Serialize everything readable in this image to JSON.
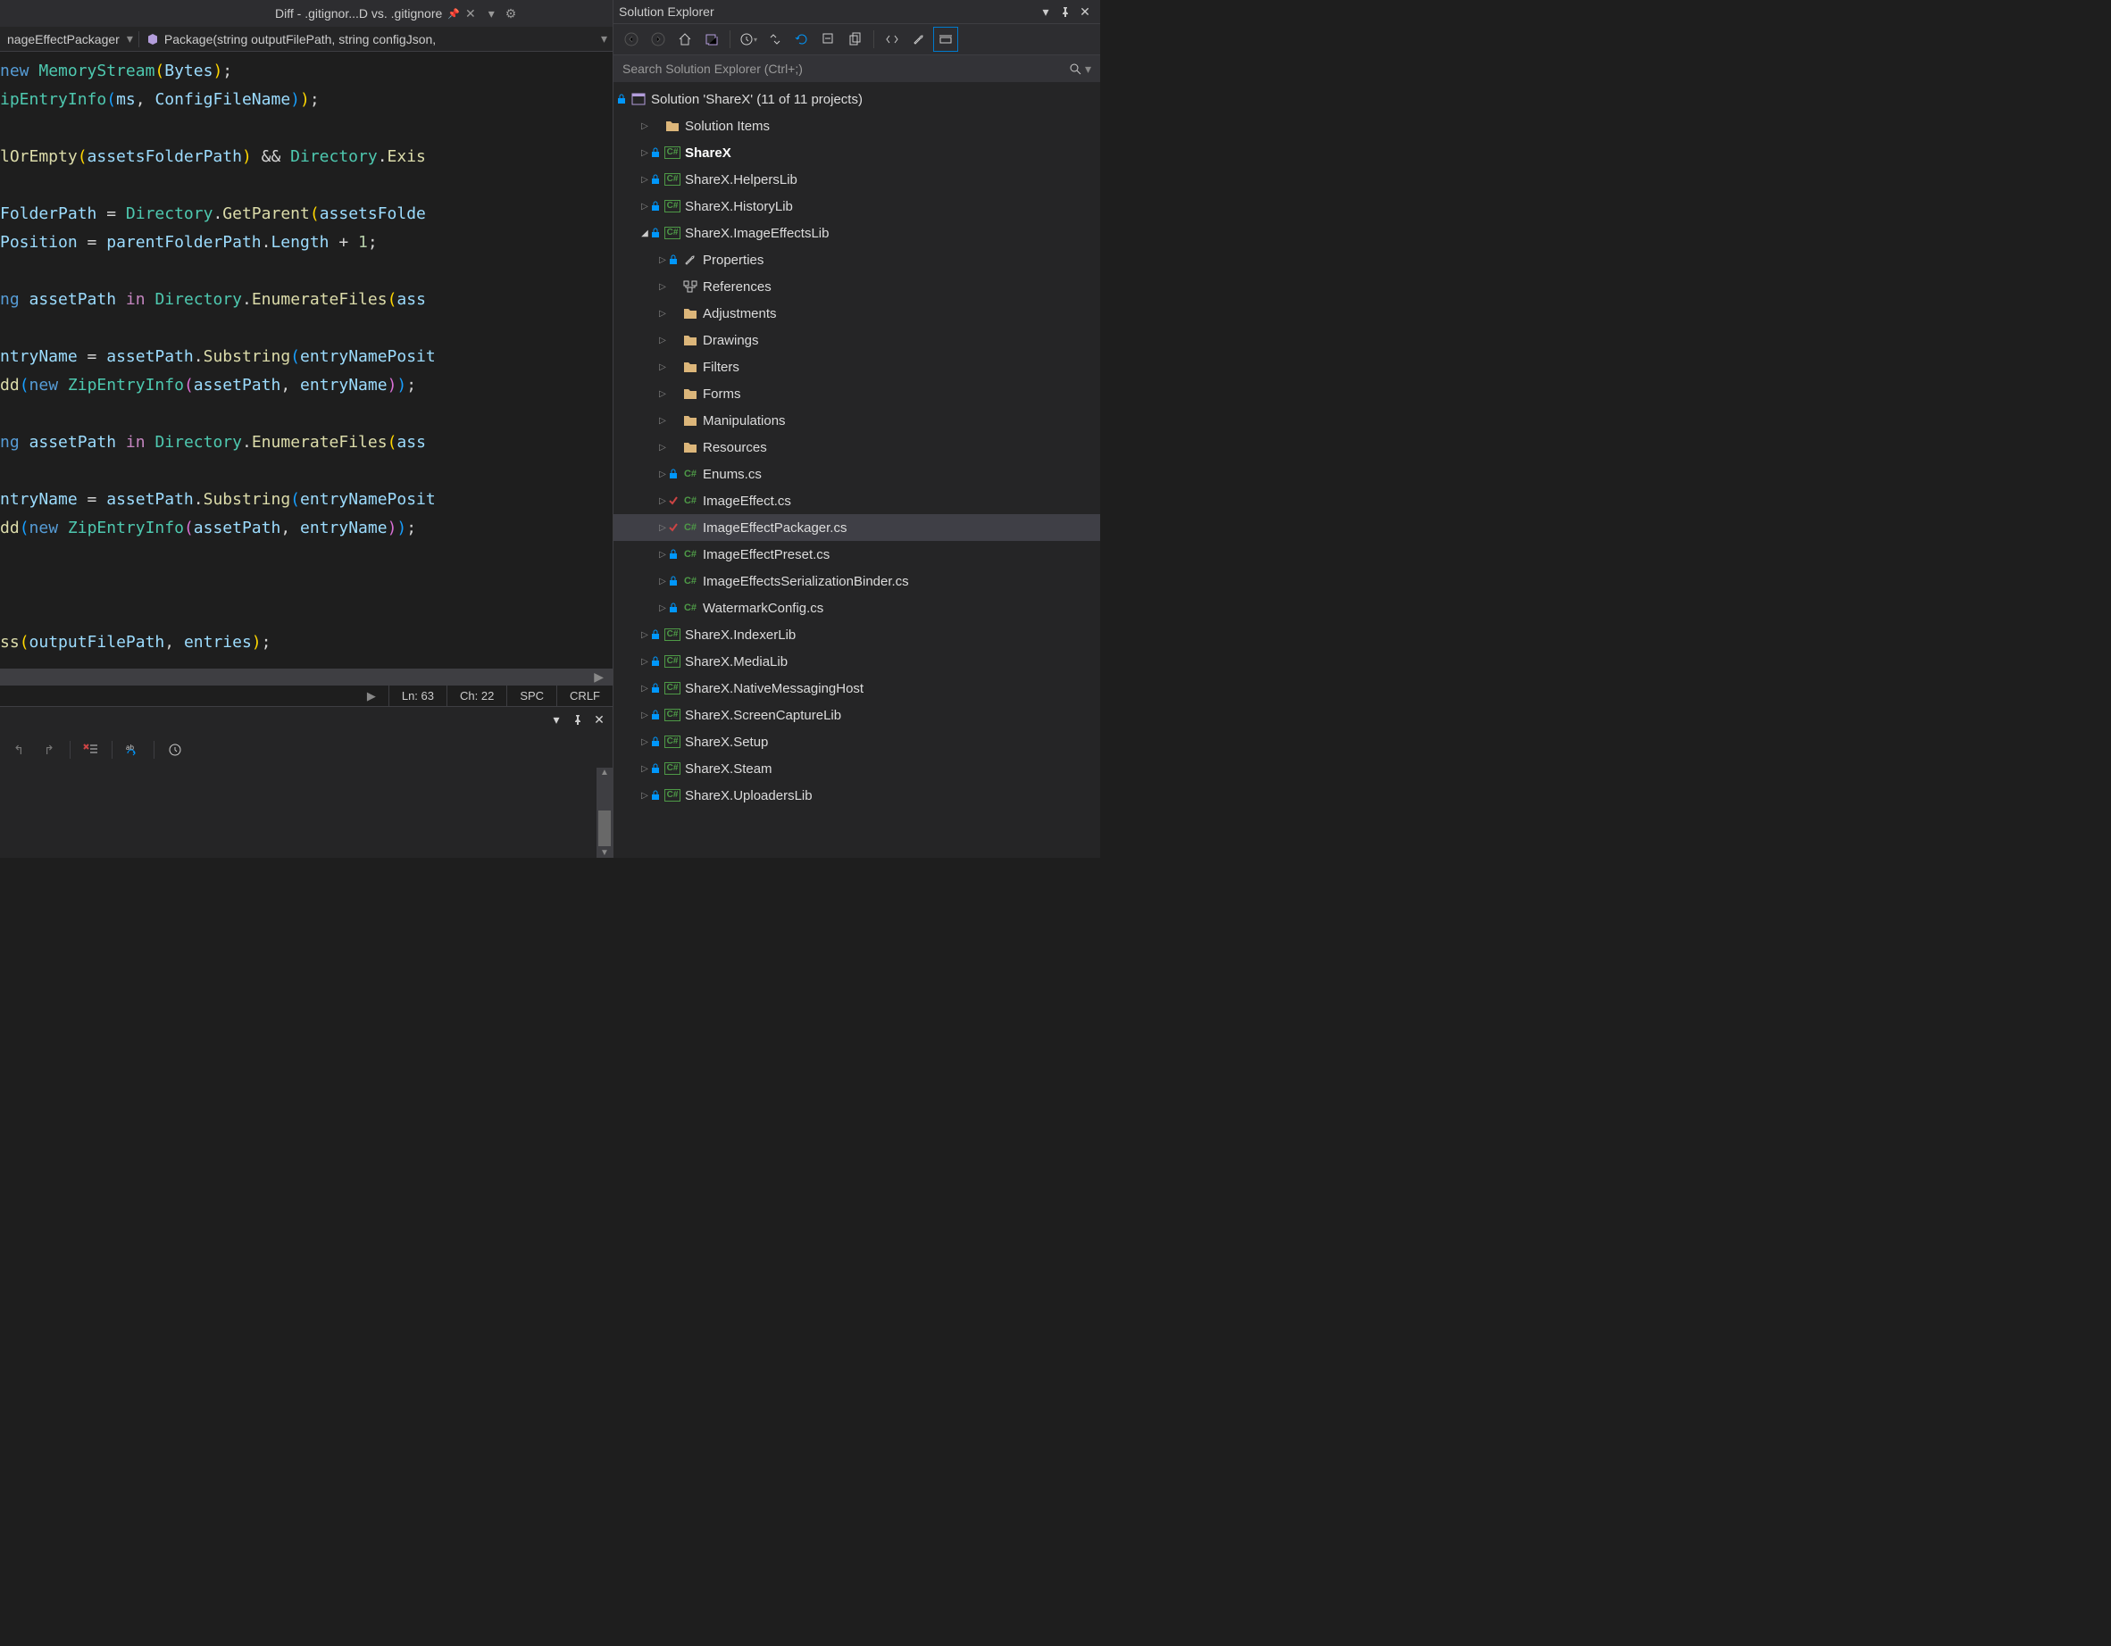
{
  "tabs": {
    "diff": {
      "label": "Diff - .gitignor...D vs. .gitignore"
    }
  },
  "breadcrumb": {
    "class": "nageEffectPackager",
    "method": "Package(string outputFilePath, string configJson,"
  },
  "code": {
    "l1": "ipEntryInfo(ms, ConfigFileName));",
    "l2": "lOrEmpty(assetsFolderPath) && Directory.Exis",
    "l3a": "FolderPath = Directory.GetParent(assetsFolde",
    "l3b": "Position = parentFolderPath.Length + 1;",
    "l4": "ng assetPath in Directory.EnumerateFiles(ass",
    "l5a": "ntryName = assetPath.Substring(entryNamePosit",
    "l5b": "dd(new ZipEntryInfo(assetPath, entryName));",
    "l6": "ng assetPath in Directory.EnumerateFiles(ass",
    "l7a": "ntryName = assetPath.Substring(entryNamePosit",
    "l7b": "dd(new ZipEntryInfo(assetPath, entryName));",
    "l8": "ss(outputFilePath, entries);"
  },
  "status": {
    "line": "Ln: 63",
    "col": "Ch: 22",
    "spc": "SPC",
    "crlf": "CRLF"
  },
  "solution_explorer": {
    "title": "Solution Explorer",
    "search_placeholder": "Search Solution Explorer (Ctrl+;)",
    "root": "Solution 'ShareX' (11 of 11 projects)",
    "items": [
      {
        "label": "Solution Items",
        "type": "folder",
        "depth": 1,
        "lock": false
      },
      {
        "label": "ShareX",
        "type": "csproj",
        "depth": 1,
        "lock": true,
        "bold": true
      },
      {
        "label": "ShareX.HelpersLib",
        "type": "csproj",
        "depth": 1,
        "lock": true
      },
      {
        "label": "ShareX.HistoryLib",
        "type": "csproj",
        "depth": 1,
        "lock": true
      },
      {
        "label": "ShareX.ImageEffectsLib",
        "type": "csproj",
        "depth": 1,
        "lock": true,
        "expanded": true
      },
      {
        "label": "Properties",
        "type": "props",
        "depth": 2,
        "lock": true
      },
      {
        "label": "References",
        "type": "refs",
        "depth": 2
      },
      {
        "label": "Adjustments",
        "type": "folder",
        "depth": 2
      },
      {
        "label": "Drawings",
        "type": "folder",
        "depth": 2
      },
      {
        "label": "Filters",
        "type": "folder",
        "depth": 2
      },
      {
        "label": "Forms",
        "type": "folder",
        "depth": 2
      },
      {
        "label": "Manipulations",
        "type": "folder",
        "depth": 2
      },
      {
        "label": "Resources",
        "type": "folder",
        "depth": 2
      },
      {
        "label": "Enums.cs",
        "type": "csfile",
        "depth": 2,
        "lock": true
      },
      {
        "label": "ImageEffect.cs",
        "type": "csfile",
        "depth": 2,
        "check": true
      },
      {
        "label": "ImageEffectPackager.cs",
        "type": "csfile",
        "depth": 2,
        "check": true,
        "selected": true
      },
      {
        "label": "ImageEffectPreset.cs",
        "type": "csfile",
        "depth": 2,
        "lock": true
      },
      {
        "label": "ImageEffectsSerializationBinder.cs",
        "type": "csfile",
        "depth": 2,
        "lock": true
      },
      {
        "label": "WatermarkConfig.cs",
        "type": "csfile",
        "depth": 2,
        "lock": true
      },
      {
        "label": "ShareX.IndexerLib",
        "type": "csproj",
        "depth": 1,
        "lock": true
      },
      {
        "label": "ShareX.MediaLib",
        "type": "csproj",
        "depth": 1,
        "lock": true
      },
      {
        "label": "ShareX.NativeMessagingHost",
        "type": "csproj",
        "depth": 1,
        "lock": true
      },
      {
        "label": "ShareX.ScreenCaptureLib",
        "type": "csproj",
        "depth": 1,
        "lock": true
      },
      {
        "label": "ShareX.Setup",
        "type": "csproj",
        "depth": 1,
        "lock": true
      },
      {
        "label": "ShareX.Steam",
        "type": "csproj",
        "depth": 1,
        "lock": true
      },
      {
        "label": "ShareX.UploadersLib",
        "type": "csproj",
        "depth": 1,
        "lock": true
      }
    ]
  }
}
